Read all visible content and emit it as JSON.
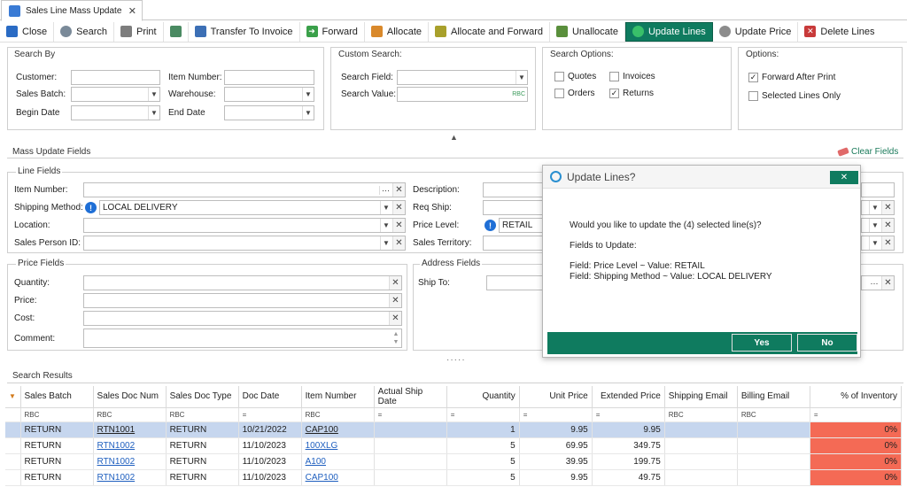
{
  "tab": {
    "title": "Sales Line Mass Update",
    "close": "✕"
  },
  "toolbar": {
    "close": "Close",
    "search": "Search",
    "print": "Print",
    "transfer": "Transfer To Invoice",
    "forward": "Forward",
    "allocate": "Allocate",
    "alloc_forward": "Allocate and Forward",
    "unallocate": "Unallocate",
    "update_lines": "Update Lines",
    "update_price": "Update Price",
    "delete_lines": "Delete Lines"
  },
  "search_by": {
    "title": "Search By",
    "customer": "Customer:",
    "sales_batch": "Sales Batch:",
    "begin_date": "Begin Date",
    "item_number": "Item Number:",
    "warehouse": "Warehouse:",
    "end_date": "End Date"
  },
  "custom_search": {
    "title": "Custom Search:",
    "field": "Search Field:",
    "value": "Search Value:",
    "value_icon": "RBC"
  },
  "search_options": {
    "title": "Search Options:",
    "quotes": "Quotes",
    "invoices": "Invoices",
    "orders": "Orders",
    "returns": "Returns"
  },
  "options": {
    "title": "Options:",
    "forward_after_print": "Forward After Print",
    "selected_only": "Selected Lines Only"
  },
  "mass_update": {
    "title": "Mass Update Fields",
    "clear": "Clear Fields"
  },
  "line_fields": {
    "title": "Line Fields",
    "item_number": "Item Number:",
    "shipping_method": "Shipping Method:",
    "shipping_value": "LOCAL DELIVERY",
    "location": "Location:",
    "sales_person": "Sales Person ID:",
    "description": "Description:",
    "req_ship": "Req Ship:",
    "price_level": "Price Level:",
    "price_level_value": "RETAIL",
    "sales_territory": "Sales Territory:"
  },
  "price_fields": {
    "title": "Price Fields",
    "quantity": "Quantity:",
    "price": "Price:",
    "cost": "Cost:",
    "comment": "Comment:"
  },
  "address_fields": {
    "title": "Address Fields",
    "ship_to": "Ship To:"
  },
  "results": {
    "title": "Search Results",
    "columns": [
      "Sales Batch",
      "Sales Doc Num",
      "Sales Doc Type",
      "Doc Date",
      "Item Number",
      "Actual Ship Date",
      "Quantity",
      "Unit Price",
      "Extended Price",
      "Shipping Email",
      "Billing Email",
      "% of Inventory"
    ],
    "filter_text": "RBC",
    "filter_eq": "=",
    "rows": [
      {
        "batch": "RETURN",
        "doc": "RTN1001",
        "type": "RETURN",
        "date": "10/21/2022",
        "item": "CAP100",
        "ship": "",
        "qty": "1",
        "unit": "9.95",
        "ext": "9.95",
        "semail": "",
        "bemail": "",
        "pct": "0%"
      },
      {
        "batch": "RETURN",
        "doc": "RTN1002",
        "type": "RETURN",
        "date": "11/10/2023",
        "item": "100XLG",
        "ship": "",
        "qty": "5",
        "unit": "69.95",
        "ext": "349.75",
        "semail": "",
        "bemail": "",
        "pct": "0%"
      },
      {
        "batch": "RETURN",
        "doc": "RTN1002",
        "type": "RETURN",
        "date": "11/10/2023",
        "item": "A100",
        "ship": "",
        "qty": "5",
        "unit": "39.95",
        "ext": "199.75",
        "semail": "",
        "bemail": "",
        "pct": "0%"
      },
      {
        "batch": "RETURN",
        "doc": "RTN1002",
        "type": "RETURN",
        "date": "11/10/2023",
        "item": "CAP100",
        "ship": "",
        "qty": "5",
        "unit": "9.95",
        "ext": "49.75",
        "semail": "",
        "bemail": "",
        "pct": "0%"
      }
    ]
  },
  "dialog": {
    "title": "Update Lines?",
    "question": "Would you like to update the (4) selected line(s)?",
    "fields_label": "Fields to Update:",
    "field1": "Field: Price Level ~ Value: RETAIL",
    "field2": "Field: Shipping Method ~ Value: LOCAL DELIVERY",
    "yes": "Yes",
    "no": "No",
    "close": "✕"
  },
  "colors": {
    "accent": "#0f7b5f",
    "selection": "#c6d6ee",
    "alert": "#f46a55",
    "link": "#1f5fbf"
  }
}
